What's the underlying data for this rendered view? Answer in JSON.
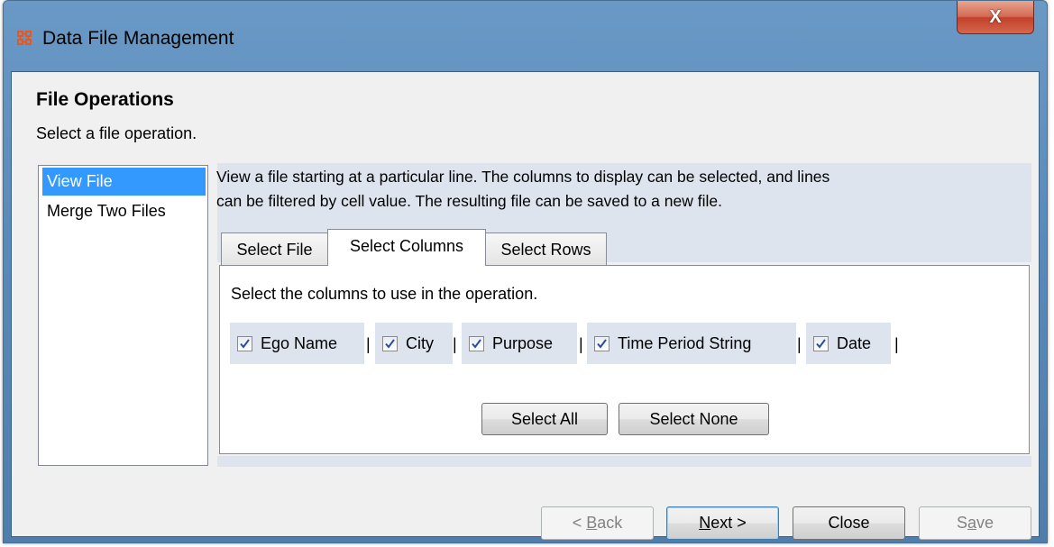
{
  "window": {
    "title": "Data File Management",
    "close_label": "X",
    "icon_color": "#e8571e"
  },
  "header": {
    "title": "File Operations",
    "subtitle": "Select a file operation."
  },
  "operations": [
    {
      "label": "View File",
      "selected": true
    },
    {
      "label": "Merge Two Files",
      "selected": false
    }
  ],
  "description": {
    "line1": "View a file starting at a particular line. The columns to display can be selected, and lines",
    "line2": "can be filtered by cell value. The resulting file can be saved to a new file."
  },
  "tabs": [
    {
      "label": "Select File",
      "active": false
    },
    {
      "label": "Select Columns",
      "active": true
    },
    {
      "label": "Select Rows",
      "active": false
    }
  ],
  "panel": {
    "instruction": "Select the columns to use in the operation.",
    "columns": [
      {
        "label": "Ego Name",
        "checked": true
      },
      {
        "label": "City",
        "checked": true
      },
      {
        "label": "Purpose",
        "checked": true
      },
      {
        "label": "Time Period String",
        "checked": true
      },
      {
        "label": "Date",
        "checked": true
      }
    ],
    "separator": "|",
    "select_all_label": "Select All",
    "select_none_label": "Select None"
  },
  "footer": {
    "back_label": "< Back",
    "back_mnemonic": "B",
    "next_label": "Next >",
    "next_mnemonic": "N",
    "close_label": "Close",
    "save_label": "Save",
    "save_mnemonic": "a"
  },
  "colors": {
    "selection": "#3399ff",
    "panel_tint": "#dde4ee",
    "title_gradient_top": "#6a99c6",
    "check_color": "#2b4e9b"
  }
}
